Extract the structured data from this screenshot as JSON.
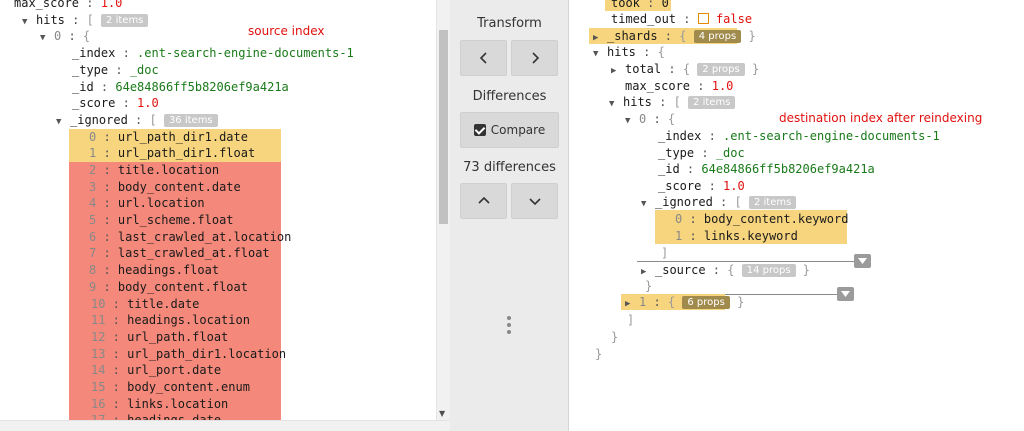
{
  "left": {
    "rows": [
      {
        "ind": 14,
        "tri": "",
        "key": "max_score",
        "val": "1.0",
        "vtype": "num"
      },
      {
        "ind": 22,
        "tri": "▼",
        "key": "hits",
        "badge": "2 items",
        "open": "["
      },
      {
        "ind": 40,
        "tri": "▼",
        "key": "0",
        "open": "{"
      },
      {
        "ind": 72,
        "tri": "",
        "key": "_index",
        "val": ".ent-search-engine-documents-1",
        "vtype": "str"
      },
      {
        "ind": 72,
        "tri": "",
        "key": "_type",
        "val": "_doc",
        "vtype": "str"
      },
      {
        "ind": 72,
        "tri": "",
        "key": "_id",
        "val": "64e84866ff5b8206ef9a421a",
        "vtype": "str"
      },
      {
        "ind": 72,
        "tri": "",
        "key": "_score",
        "val": "1.0",
        "vtype": "num"
      },
      {
        "ind": 56,
        "tri": "▼",
        "key": "_ignored",
        "badge": "36 items",
        "open": "["
      }
    ],
    "note": "source index",
    "ignored_items": [
      {
        "i": "0",
        "v": "url_path_dir1.date",
        "hl": "y"
      },
      {
        "i": "1",
        "v": "url_path_dir1.float",
        "hl": "y"
      },
      {
        "i": "2",
        "v": "title.location",
        "hl": "r"
      },
      {
        "i": "3",
        "v": "body_content.date",
        "hl": "r"
      },
      {
        "i": "4",
        "v": "url.location",
        "hl": "r"
      },
      {
        "i": "5",
        "v": "url_scheme.float",
        "hl": "r"
      },
      {
        "i": "6",
        "v": "last_crawled_at.location",
        "hl": "r"
      },
      {
        "i": "7",
        "v": "last_crawled_at.float",
        "hl": "r"
      },
      {
        "i": "8",
        "v": "headings.float",
        "hl": "r"
      },
      {
        "i": "9",
        "v": "body_content.float",
        "hl": "r"
      },
      {
        "i": "10",
        "v": "title.date",
        "hl": "r"
      },
      {
        "i": "11",
        "v": "headings.location",
        "hl": "r"
      },
      {
        "i": "12",
        "v": "url_path.float",
        "hl": "r"
      },
      {
        "i": "13",
        "v": "url_path_dir1.location",
        "hl": "r"
      },
      {
        "i": "14",
        "v": "url_port.date",
        "hl": "r"
      },
      {
        "i": "15",
        "v": "body_content.enum",
        "hl": "r"
      },
      {
        "i": "16",
        "v": "links.location",
        "hl": "r"
      },
      {
        "i": "17",
        "v": "headings.date",
        "hl": "r"
      }
    ]
  },
  "middle": {
    "transform_label": "Transform",
    "differences_label": "Differences",
    "compare_label": "Compare",
    "diff_count": "73 differences",
    "icons": {
      "left": "chevron-left-icon",
      "right": "chevron-right-icon",
      "up": "chevron-up-icon",
      "down": "chevron-down-icon",
      "check": "checkbox-checked-icon",
      "handle": "drag-handle-icon"
    }
  },
  "right": {
    "took_key": "took",
    "took_val": "0",
    "timed_out_key": "timed_out",
    "timed_out_val": "false",
    "shards_key": "_shards",
    "shards_badge": "4 props",
    "hits_key": "hits",
    "total_key": "total",
    "total_badge": "2 props",
    "max_score_key": "max_score",
    "max_score_val": "1.0",
    "inner_hits_key": "hits",
    "inner_hits_badge": "2 items",
    "zero_key": "0",
    "note": "destination index after reindexing",
    "index_key": "_index",
    "index_val": ".ent-search-engine-documents-1",
    "type_key": "_type",
    "type_val": "_doc",
    "id_key": "_id",
    "id_val": "64e84866ff5b8206ef9a421a",
    "score_key": "_score",
    "score_val": "1.0",
    "ignored_key": "_ignored",
    "ignored_badge": "2 items",
    "ignored_items": [
      {
        "i": "0",
        "v": "body_content.keyword"
      },
      {
        "i": "1",
        "v": "links.keyword"
      }
    ],
    "source_key": "_source",
    "source_badge": "14 props",
    "one_key": "1",
    "one_badge": "6 props"
  }
}
